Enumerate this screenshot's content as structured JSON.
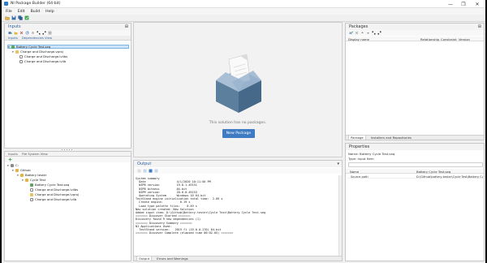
{
  "window": {
    "title": "NI Package Builder (64-bit)",
    "controls": [
      "—",
      "❐",
      "✕"
    ]
  },
  "menu": [
    "File",
    "Edit",
    "Build",
    "Help"
  ],
  "inputs_panel": {
    "title": "Inputs",
    "pin": "⊞",
    "tabs": [
      "Inputs",
      "Dependencies View"
    ],
    "tree": [
      {
        "label": "Battery Cycle Test.seq",
        "twisty": "▾",
        "selected": true
      },
      {
        "label": "Charge and Discharge.vproj",
        "twisty": "▾"
      },
      {
        "label": "Charge and Discharge.lvlibs",
        "twisty": ""
      },
      {
        "label": "Charge and Discharge.lvlib",
        "twisty": ""
      }
    ]
  },
  "files_panel": {
    "tabs": [
      "Inputs",
      "File System View"
    ],
    "tree": [
      {
        "label": "C:",
        "twisty": "▾"
      },
      {
        "label": "Github",
        "twisty": "▾"
      },
      {
        "label": "Battery tester",
        "twisty": "▾"
      },
      {
        "label": "Cycle Test",
        "twisty": "▾"
      },
      {
        "label": "Battery Cycle Test.seq",
        "twisty": ""
      },
      {
        "label": "Charge and Discharge.lvlibs",
        "twisty": ""
      },
      {
        "label": "Charge and Discharge.lvproj",
        "twisty": ""
      },
      {
        "label": "Charge and Discharge.lvlib",
        "twisty": ""
      }
    ]
  },
  "center": {
    "empty_message": "This solution has no packages.",
    "new_package": "New Package"
  },
  "output_panel": {
    "title": "Output",
    "pin": "▾",
    "lines": [
      "System summary",
      "  Date                  4/1/2020 10:11:56 PM",
      "  NIPB version          19.0.1.49151",
      "  NIPB bitness          64-bit",
      "  NIPM version          20.0.0.49153",
      "  Operating System      Windows 10 64-bit",
      "TestStand engine initialization total time:  2.09 s",
      "  Create engine:          0.19 s",
      "  Load type palette files:    0.49 s",
      "New solution created: New Solution",
      "Added input item: D:\\Github\\Battery-tester\\Cycle Test\\Battery Cycle Test.seq",
      "======= Discover Started =======",
      "Discovery found 9 new dependencies (1)",
      "======= Discovery Summary =======",
      "NI Applications Used:",
      "  TestStand version:   2019 f1 (19.0.0.170) 64-bit",
      "======= Discover Complete (elapsed time 00:02.05) ======="
    ],
    "tabs": [
      "Output",
      "Errors and Warnings"
    ]
  },
  "packages_panel": {
    "title": "Packages",
    "pin": "⊞",
    "columns": [
      "Display name",
      "Relationship",
      "Constraint",
      "Version"
    ],
    "tabs": [
      "Package",
      "Installers and Repositories"
    ]
  },
  "properties_panel": {
    "title": "Properties",
    "name_line": "Name:  Battery Cycle Test.seq",
    "type_line": "Type:   Input Item",
    "columns": [
      "Name",
      "Battery Cycle Test.seq"
    ],
    "rows": [
      {
        "key": "Source path",
        "value": "D:\\Github\\battery-tester\\Cycle Test\\Battery Cycle Test.seq"
      }
    ]
  },
  "colors": {
    "accent": "#3e7bc2",
    "panel_title": "#2a5fa0",
    "selection": "#cde3f7"
  }
}
